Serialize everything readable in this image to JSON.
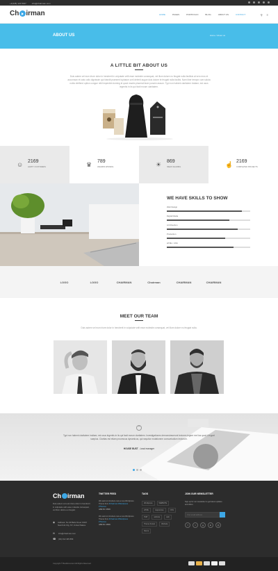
{
  "topbar": {
    "phone": "+1(345) 123 5047",
    "email": "info@chairman.com"
  },
  "brand": {
    "name_before": "Ch",
    "name_after": "irman"
  },
  "nav": {
    "items": [
      "HOME",
      "PAGES",
      "PORTFOLIO",
      "BLOG",
      "ABOUT US",
      "CONTACT"
    ]
  },
  "banner": {
    "title": "ABOUT US",
    "breadcrumb": "Home  /  About us"
  },
  "about": {
    "title": "A LITTLE BIT ABOUT US",
    "text": "Duis autem vel eum iriure dolor in hendrerit in vulputate velit esse molestie consequat, vel illum dolore eu feugiat nulla facilisis at vero eros et accumsan et iusto odio dignissim qui blandit praesent luptatum zzril delenit augue duis dolore te feugait nulla facilisi. Nam liber tempor cum soluta nobis eleifend option congue nihil imperdiet doming id quod mazim placerat facer possim assum. Typi non habent claritatem insitam; est usus legentis in iis qui facit eorum claritatem."
  },
  "stats": [
    {
      "icon": "people-icon",
      "value": "2169",
      "label": "Happy customers"
    },
    {
      "icon": "trophy-icon",
      "value": "789",
      "label": "Awards winning"
    },
    {
      "icon": "bulb-icon",
      "value": "869",
      "label": "Ideas sharing"
    },
    {
      "icon": "thumbs-up-icon",
      "value": "2169",
      "label": "Completed projects"
    }
  ],
  "skills": {
    "title": "WE HAVE SKILLS TO SHOW",
    "items": [
      {
        "label": "Web Design",
        "value": 90
      },
      {
        "label": "Digital Media",
        "value": 75
      },
      {
        "label": "Art Direction",
        "value": 85
      },
      {
        "label": "Production",
        "value": 70
      },
      {
        "label": "HTML / CSS",
        "value": 80
      }
    ]
  },
  "brands": [
    {
      "title": "LOGO",
      "sub": ""
    },
    {
      "title": "LOGO",
      "sub": ""
    },
    {
      "title": "CHAIRMAN",
      "sub": ""
    },
    {
      "title": "Chairman",
      "sub": ""
    },
    {
      "title": "CHAIRMAN",
      "sub": ""
    },
    {
      "title": "CHAIRMAN",
      "sub": ""
    }
  ],
  "team": {
    "title": "MEET OUR TEAM",
    "text": "Duis autem vel eum iriure dolor in hendrerit in vulputate velit esse molestie consequat, vel illum dolore eu feugiat nulla."
  },
  "testimonial": {
    "icon": "quote-icon",
    "text": "Typi non habent claritatem insitam; est usus legentis in iis qui facit eorum claritatem. Investigationes demonstraverunt lectores legere me lius quod ii legunt saepius. Claritas est etiam processus dynamicus, qui sequitur mutationem consuetudium lectorum.",
    "author": "HOUSE BUST",
    "role": "- Lead manager"
  },
  "footer": {
    "about": "Duis autem vel eum iriure dolor in hendrerit in vulputate velit esse molestie consequat, vel illum dolore eu feugiat.",
    "address": "Address: No 40 Baria Sreet 133/2 NewYork City, NY, United States.",
    "email": "info@chairman.com",
    "phone": "(02) 012 345 889",
    "twitter_title": "TWITTER FEED",
    "tweets": [
      {
        "text": "We want to introduce new a new Wordpress Theme from",
        "link": "#Chairman #Wordpress #Themes",
        "date": "JAN 01 / 2016"
      },
      {
        "text": "We want to introduce new a new Wordpress Theme from",
        "link": "#Chairman #Wordpress #Themes",
        "date": "JAN 01 / 2016"
      }
    ],
    "tags_title": "TAGS",
    "tags": [
      "Wordpress",
      "WEBSITE",
      "HTML",
      "responsive",
      "CSS",
      "PHP",
      "website",
      "web",
      "Theme Forest",
      "Website",
      "theme"
    ],
    "newsletter_title": "JOIN OUR NEWSLETTER",
    "newsletter_text": "Sign up for our newsletter to get latest updates and offers.",
    "newsletter_placeholder": "Your email address",
    "copyright": "Copyright © BestDocument All Rights Reserved"
  }
}
